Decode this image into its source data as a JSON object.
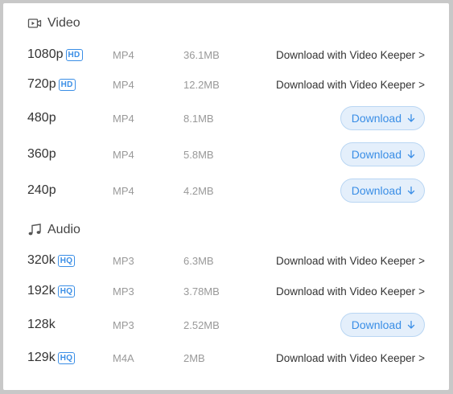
{
  "sections": {
    "video": {
      "title": "Video",
      "icon": "video-icon"
    },
    "audio": {
      "title": "Audio",
      "icon": "music-note-icon"
    }
  },
  "video_rows": [
    {
      "quality": "1080p",
      "badge": "HD",
      "format": "MP4",
      "size": "36.1MB",
      "action": "Download with Video Keeper",
      "action_suffix": ">"
    },
    {
      "quality": "720p",
      "badge": "HD",
      "format": "MP4",
      "size": "12.2MB",
      "action": "Download with Video Keeper",
      "action_suffix": ">"
    },
    {
      "quality": "480p",
      "badge": "",
      "format": "MP4",
      "size": "8.1MB",
      "action": "Download",
      "action_suffix": ""
    },
    {
      "quality": "360p",
      "badge": "",
      "format": "MP4",
      "size": "5.8MB",
      "action": "Download",
      "action_suffix": ""
    },
    {
      "quality": "240p",
      "badge": "",
      "format": "MP4",
      "size": "4.2MB",
      "action": "Download",
      "action_suffix": ""
    }
  ],
  "audio_rows": [
    {
      "quality": "320k",
      "badge": "HQ",
      "format": "MP3",
      "size": "6.3MB",
      "action": "Download with Video Keeper",
      "action_suffix": ">"
    },
    {
      "quality": "192k",
      "badge": "HQ",
      "format": "MP3",
      "size": "3.78MB",
      "action": "Download with Video Keeper",
      "action_suffix": ">"
    },
    {
      "quality": "128k",
      "badge": "",
      "format": "MP3",
      "size": "2.52MB",
      "action": "Download",
      "action_suffix": ""
    },
    {
      "quality": "129k",
      "badge": "HQ",
      "format": "M4A",
      "size": "2MB",
      "action": "Download with Video Keeper",
      "action_suffix": ">"
    }
  ],
  "colors": {
    "accent": "#3a8ee6",
    "button_bg": "#e4effb",
    "muted_text": "#999999"
  }
}
